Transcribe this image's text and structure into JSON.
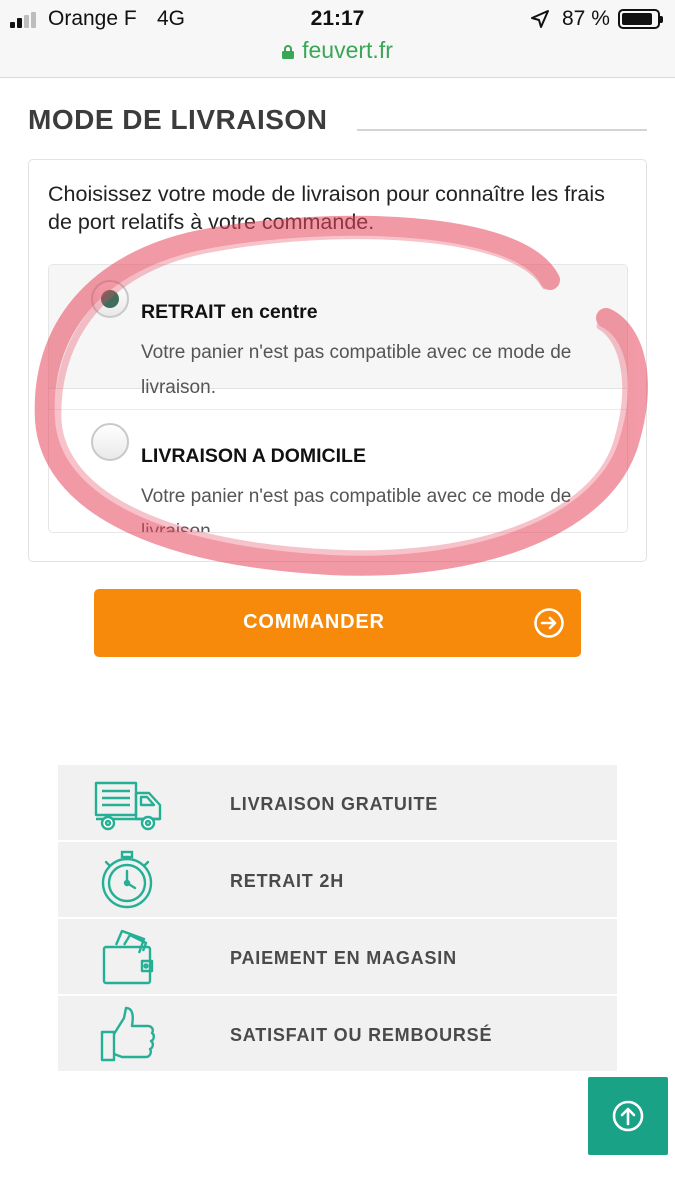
{
  "status_bar": {
    "carrier": "Orange F",
    "network": "4G",
    "time": "21:17",
    "battery_percent": "87 %",
    "battery_level": 0.87,
    "signal_bars": 2,
    "url": "feuvert.fr"
  },
  "page": {
    "section_title": "MODE DE LIVRAISON"
  },
  "delivery": {
    "intro": "Choisissez votre mode de livraison pour connaître les frais de port relatifs à votre commande.",
    "options": [
      {
        "title": "RETRAIT en centre",
        "description": "Votre panier n'est pas compatible avec ce mode de livraison.",
        "selected": true
      },
      {
        "title": "LIVRAISON A DOMICILE",
        "description": "Votre panier n'est pas compatible avec ce mode de livraison.",
        "selected": false
      }
    ]
  },
  "cta": {
    "label": "COMMANDER",
    "icon": "arrow-right-circle-icon"
  },
  "benefits": [
    {
      "label": "LIVRAISON GRATUITE",
      "icon": "truck-icon"
    },
    {
      "label": "RETRAIT 2H",
      "icon": "stopwatch-icon"
    },
    {
      "label": "PAIEMENT EN MAGASIN",
      "icon": "wallet-icon"
    },
    {
      "label": "SATISFAIT OU REMBOURSÉ",
      "icon": "thumbs-up-icon"
    }
  ],
  "back_to_top": {
    "icon": "arrow-up-circle-icon"
  },
  "colors": {
    "accent_orange": "#f7890b",
    "accent_green": "#1aa287",
    "icon_teal": "#25b096",
    "highlight_red": "#e8475f",
    "url_green": "#3aa757"
  }
}
